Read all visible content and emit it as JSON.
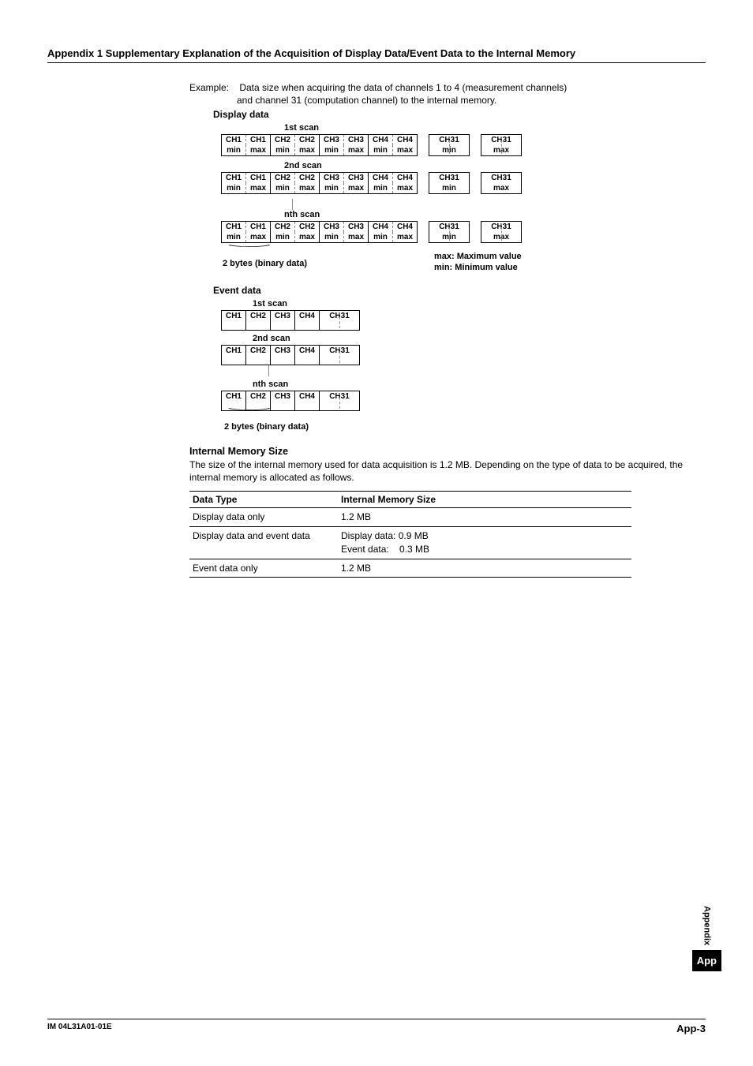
{
  "header_title": "Appendix 1  Supplementary Explanation of the Acquisition of Display Data/Event Data to the Internal Memory",
  "example_prefix": "Example:",
  "example_line1": "Data size when acquiring the data of channels 1 to 4 (measurement channels)",
  "example_line2": "and channel 31 (computation channel) to the internal memory.",
  "display_data_label": "Display data",
  "scan_labels": {
    "s1": "1st scan",
    "s2": "2nd scan",
    "sn": "nth scan"
  },
  "ch_labels": {
    "ch1": "CH1",
    "ch2": "CH2",
    "ch3": "CH3",
    "ch4": "CH4",
    "ch31": "CH31"
  },
  "min": "min",
  "max": "max",
  "binary_note": "2 bytes (binary data)",
  "legend_max": "max: Maximum value",
  "legend_min": "min:  Minimum value",
  "event_data_label": "Event data",
  "subheading": "Internal Memory Size",
  "paragraph": "The size of the internal memory used for data acquisition is 1.2 MB.  Depending on the type of data to be acquired, the internal memory is allocated as follows.",
  "table": {
    "h1": "Data Type",
    "h2": "Internal Memory Size",
    "r1c1": "Display data only",
    "r1c2": "1.2 MB",
    "r2c1": "Display data and event data",
    "r2c2a": "Display data:  0.9 MB",
    "r2c2b": "Event data:    0.3 MB",
    "r3c1": "Event data only",
    "r3c2": "1.2 MB"
  },
  "sidetab_text": "Appendix",
  "sidetab_box": "App",
  "footer_left": "IM 04L31A01-01E",
  "footer_right": "App-3"
}
